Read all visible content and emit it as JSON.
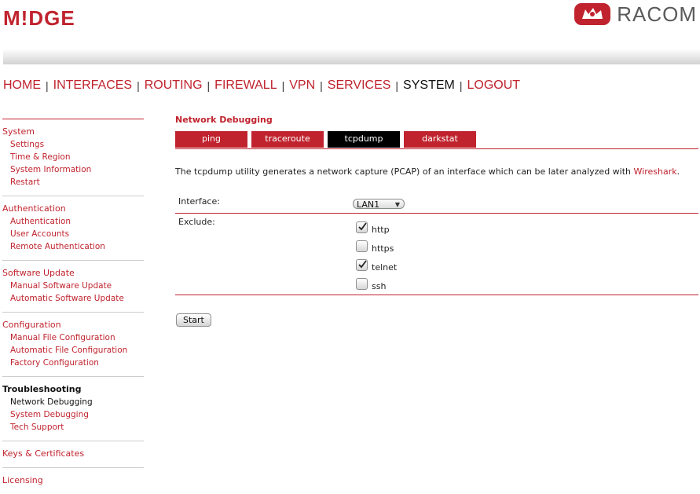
{
  "brand": {
    "logo_text": "M!DGE",
    "vendor_text": "RACOM"
  },
  "colors": {
    "accent": "#c0232e",
    "active_tab": "#000000",
    "text": "#222222"
  },
  "topnav": {
    "separator": "|",
    "items": [
      {
        "label": "HOME"
      },
      {
        "label": "INTERFACES"
      },
      {
        "label": "ROUTING"
      },
      {
        "label": "FIREWALL"
      },
      {
        "label": "VPN"
      },
      {
        "label": "SERVICES"
      },
      {
        "label": "SYSTEM"
      },
      {
        "label": "LOGOUT"
      }
    ],
    "active": "SYSTEM"
  },
  "sidebar": {
    "groups": [
      {
        "title": "System",
        "items": [
          "Settings",
          "Time & Region",
          "System Information",
          "Restart"
        ]
      },
      {
        "title": "Authentication",
        "items": [
          "Authentication",
          "User Accounts",
          "Remote Authentication"
        ]
      },
      {
        "title": "Software Update",
        "items": [
          "Manual Software Update",
          "Automatic Software Update"
        ]
      },
      {
        "title": "Configuration",
        "items": [
          "Manual File Configuration",
          "Automatic File Configuration",
          "Factory Configuration"
        ]
      },
      {
        "title": "Troubleshooting",
        "items": [
          "Network Debugging",
          "System Debugging",
          "Tech Support"
        ]
      },
      {
        "title": "Keys & Certificates",
        "items": []
      },
      {
        "title": "Licensing",
        "items": []
      }
    ],
    "active_group": "Troubleshooting",
    "active_item": "Network Debugging"
  },
  "main": {
    "title": "Network Debugging",
    "tabs": [
      {
        "label": "ping"
      },
      {
        "label": "traceroute"
      },
      {
        "label": "tcpdump"
      },
      {
        "label": "darkstat"
      }
    ],
    "active_tab": "tcpdump",
    "intro_text": "The tcpdump utility generates a network capture (PCAP) of an interface which can be later analyzed with",
    "intro_link": "Wireshark",
    "intro_end": ".",
    "interface_label": "Interface:",
    "interface_value": "LAN1",
    "exclude_label": "Exclude:",
    "exclude_options": [
      {
        "label": "http",
        "checked": true
      },
      {
        "label": "https",
        "checked": false
      },
      {
        "label": "telnet",
        "checked": true
      },
      {
        "label": "ssh",
        "checked": false
      }
    ],
    "start_button": "Start"
  }
}
